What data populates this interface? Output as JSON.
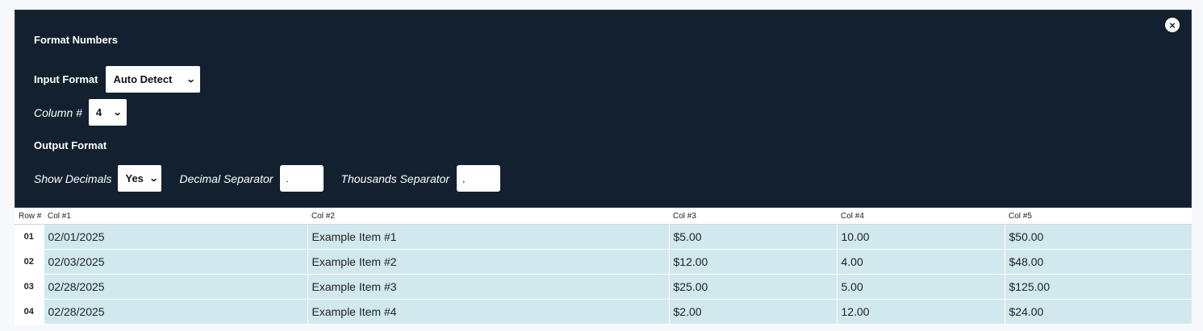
{
  "dialog": {
    "title": "Format Numbers",
    "close_icon": "×",
    "input_format": {
      "label": "Input Format",
      "value": "Auto Detect"
    },
    "column": {
      "label": "Column #",
      "value": "4"
    },
    "output_format": {
      "heading": "Output Format",
      "show_decimals": {
        "label": "Show Decimals",
        "value": "Yes"
      },
      "decimal_separator": {
        "label": "Decimal Separator",
        "value": "."
      },
      "thousands_separator": {
        "label": "Thousands Separator",
        "value": ","
      }
    },
    "chevron": "⌄"
  },
  "colors": {
    "panel_bg": "#12202f",
    "row_bg": "#d1e9ee"
  },
  "table": {
    "headers": [
      "Row #",
      "Col #1",
      "Col #2",
      "Col #3",
      "Col #4",
      "Col #5"
    ],
    "rows": [
      {
        "num": "01",
        "cells": [
          "02/01/2025",
          "Example Item #1",
          "$5.00",
          "10.00",
          "$50.00"
        ]
      },
      {
        "num": "02",
        "cells": [
          "02/03/2025",
          "Example Item #2",
          "$12.00",
          "4.00",
          "$48.00"
        ]
      },
      {
        "num": "03",
        "cells": [
          "02/28/2025",
          "Example Item #3",
          "$25.00",
          "5.00",
          "$125.00"
        ]
      },
      {
        "num": "04",
        "cells": [
          "02/28/2025",
          "Example Item #4",
          "$2.00",
          "12.00",
          "$24.00"
        ]
      }
    ]
  }
}
